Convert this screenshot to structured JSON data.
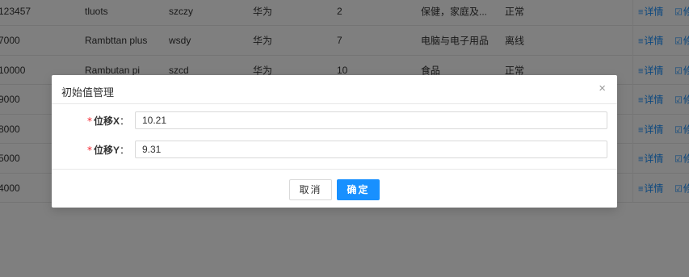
{
  "table": {
    "rows": [
      {
        "id": "123457",
        "name": "tluots",
        "code": "szczy",
        "brand": "华为",
        "qty": "2",
        "category": "保健，家庭及...",
        "status": "正常"
      },
      {
        "id": "7000",
        "name": "Rambttan plus",
        "code": "wsdy",
        "brand": "华为",
        "qty": "7",
        "category": "电脑与电子用品",
        "status": "离线"
      },
      {
        "id": "10000",
        "name": "Rambutan pi",
        "code": "szcd",
        "brand": "华为",
        "qty": "10",
        "category": "食品",
        "status": "正常"
      },
      {
        "id": "9000",
        "name": "",
        "code": "",
        "brand": "",
        "qty": "",
        "category": "",
        "status": ""
      },
      {
        "id": "8000",
        "name": "",
        "code": "",
        "brand": "",
        "qty": "",
        "category": "",
        "status": ""
      },
      {
        "id": "5000",
        "name": "",
        "code": "",
        "brand": "",
        "qty": "",
        "category": "",
        "status": ""
      },
      {
        "id": "4000",
        "name": "",
        "code": "",
        "brand": "",
        "qty": "",
        "category": "",
        "status": ""
      }
    ],
    "actions": {
      "detail_icon": "≡",
      "detail_label": "详情",
      "edit_icon": "☑",
      "edit_label": "修"
    }
  },
  "modal": {
    "title": "初始值管理",
    "close_icon": "×",
    "fields": [
      {
        "required_mark": "*",
        "label": "位移X",
        "colon": "：",
        "value": "10.21"
      },
      {
        "required_mark": "*",
        "label": "位移Y",
        "colon": "：",
        "value": "9.31"
      }
    ],
    "cancel_label": "取消",
    "ok_label": "确定"
  },
  "colors": {
    "primary": "#1890ff",
    "required": "#f5222d",
    "mask": "rgba(0,0,0,0.5)"
  }
}
